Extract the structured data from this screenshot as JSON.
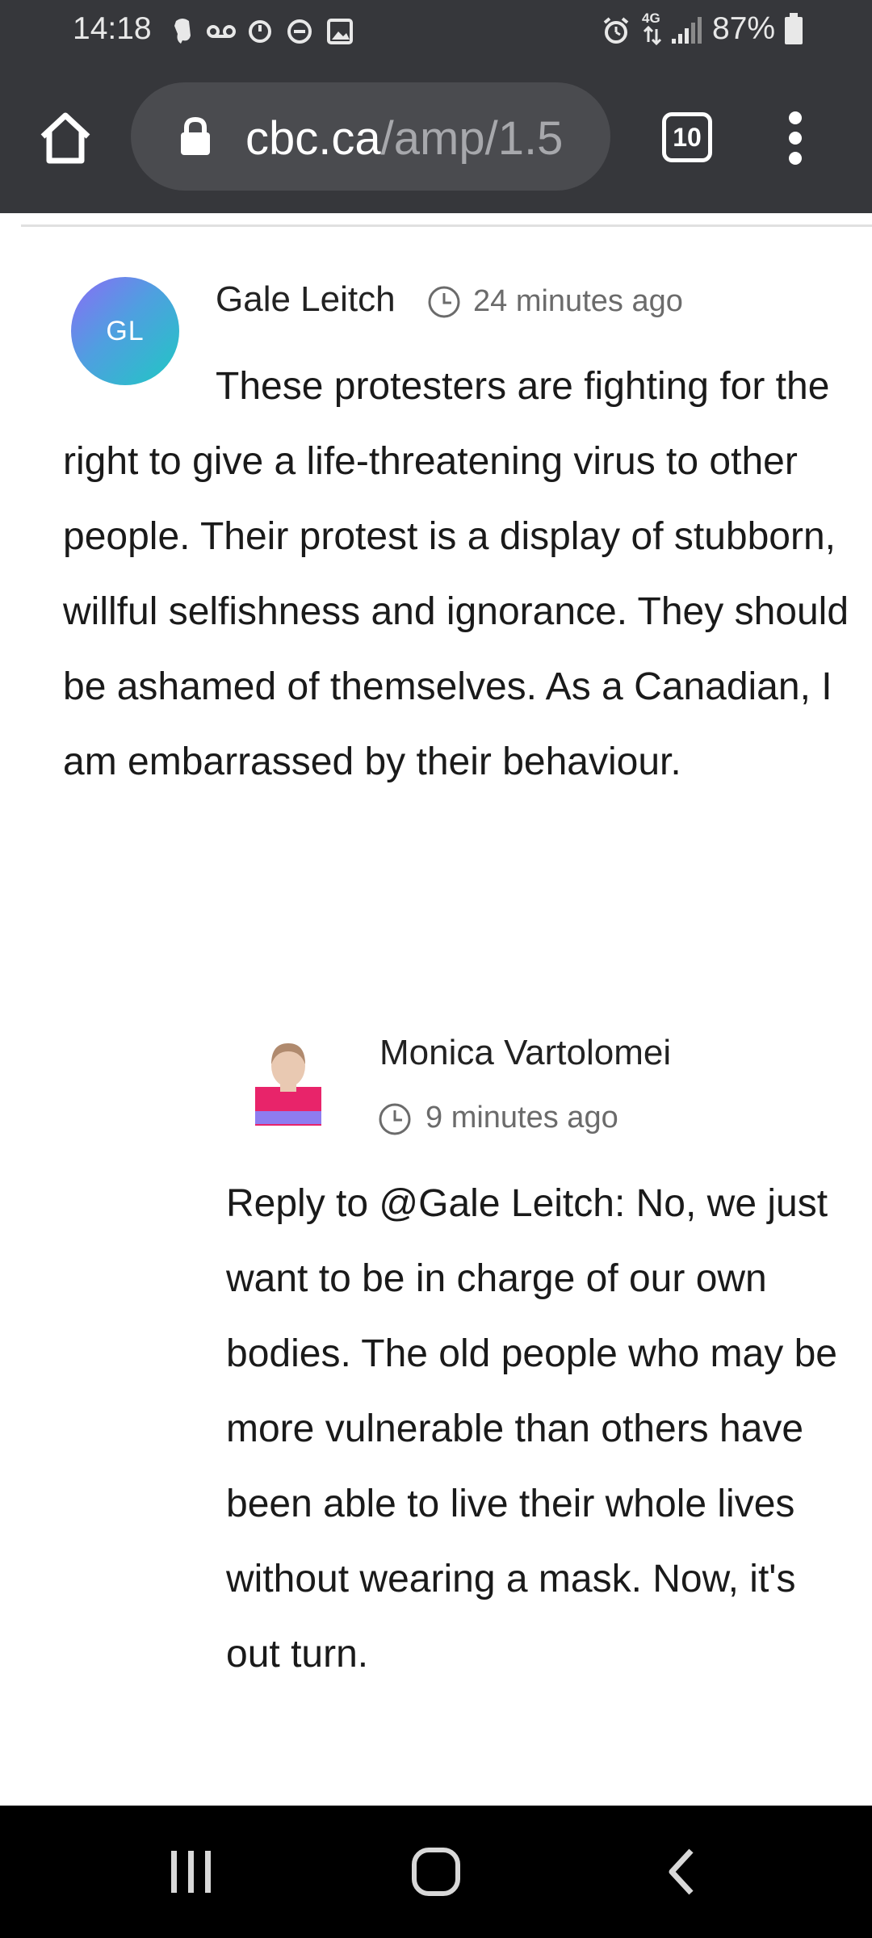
{
  "status_bar": {
    "time": "14:18",
    "network": "4G",
    "battery_percent": "87%"
  },
  "browser": {
    "url_host": "cbc.ca",
    "url_path": "/amp/1.5",
    "tab_count": "10"
  },
  "comments": [
    {
      "author": "Gale Leitch",
      "avatar_initials": "GL",
      "time_ago": "24 minutes ago",
      "text": "These protesters are fighting for the right to give a life-threatening virus to other people. Their protest is a display of stubborn, willful selfishness and ignorance. They should be ashamed of themselves. As a Canadian, I am embarrassed by their behaviour."
    },
    {
      "author": "Monica Vartolomei",
      "time_ago": "9 minutes ago",
      "text": "Reply to @Gale Leitch: No, we just want to be in charge of our own bodies. The old people who may be more vulnerable than others have been able to live their whole lives without wearing a mask. Now, it's out turn."
    }
  ],
  "colors": {
    "chrome_bg": "#36373b",
    "url_box_bg": "#4a4b4f",
    "url_path_text": "#a7a8ac",
    "meta_text": "#6b6b6b",
    "nav_bar_bg": "#000000"
  }
}
